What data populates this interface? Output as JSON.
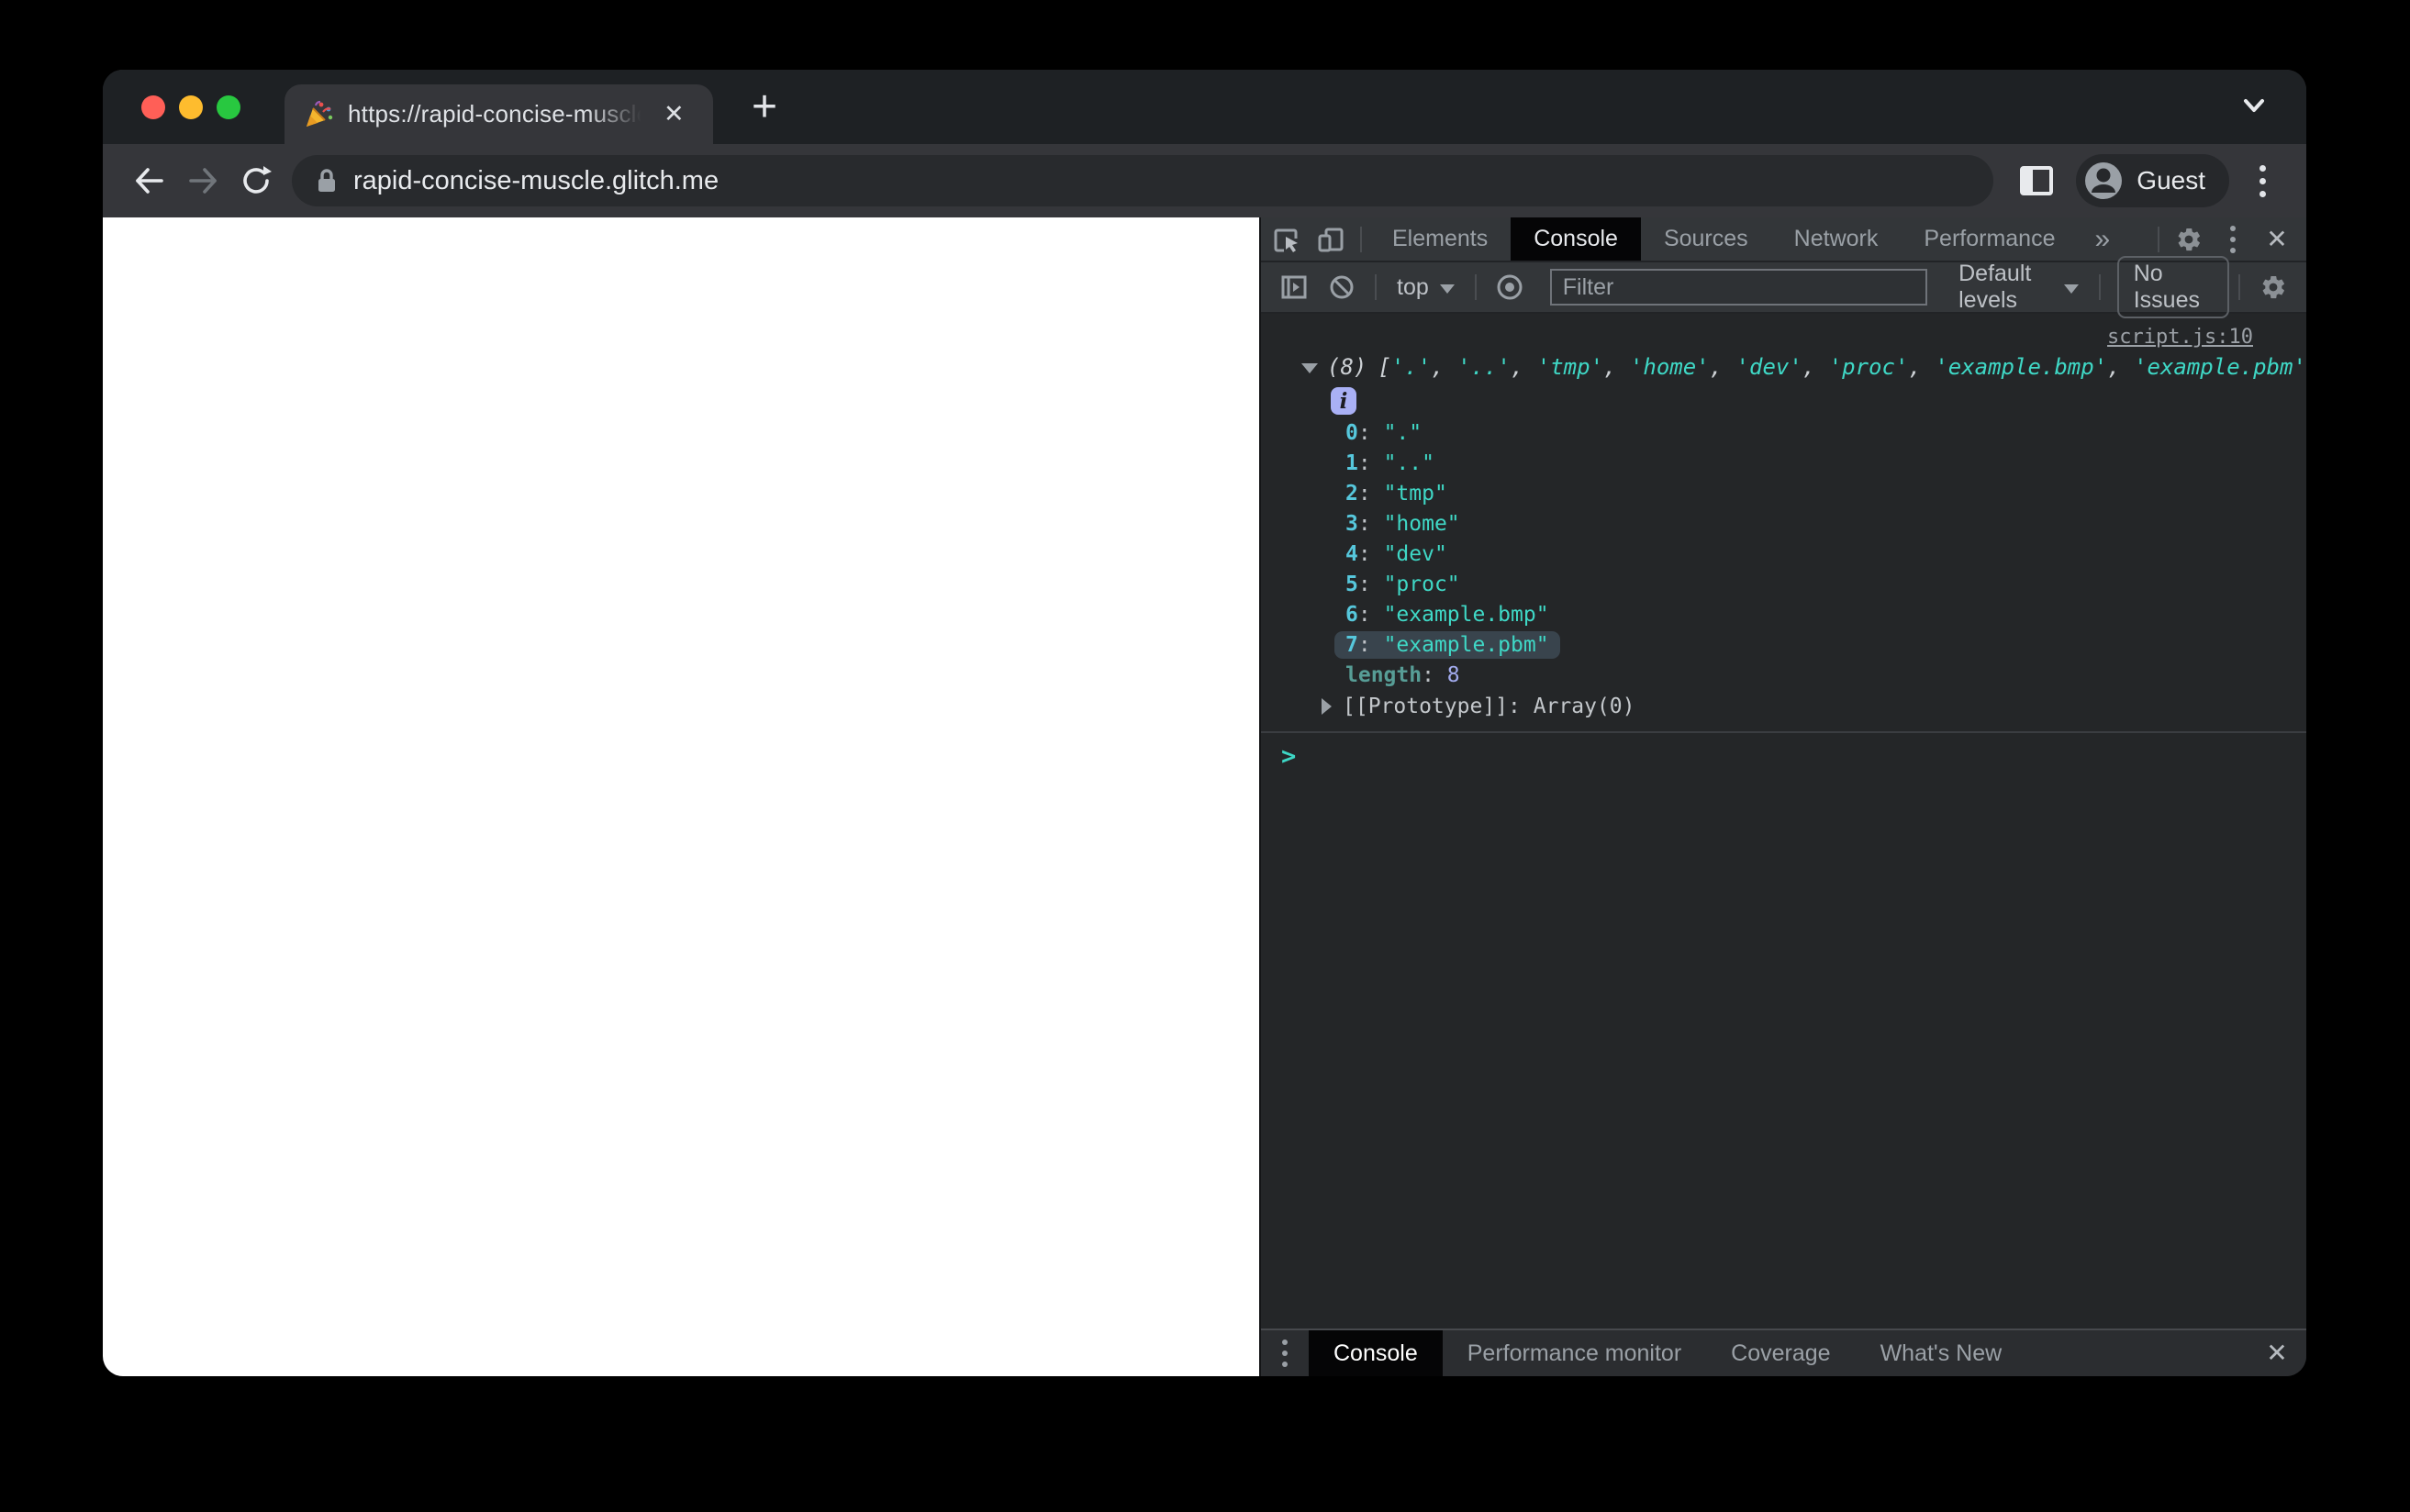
{
  "browser": {
    "tab": {
      "favicon_icon": "party-popper-icon",
      "title": "https://rapid-concise-muscle.g",
      "close_icon": "✕"
    },
    "new_tab_icon": "+",
    "url": "rapid-concise-muscle.glitch.me",
    "profile_label": "Guest"
  },
  "devtools": {
    "main_tabs": {
      "items": [
        "Elements",
        "Console",
        "Sources",
        "Network",
        "Performance"
      ],
      "active": "Console",
      "more_icon": "»"
    },
    "toolbar": {
      "context": "top",
      "filter_placeholder": "Filter",
      "levels_label": "Default levels",
      "issues_label": "No Issues"
    },
    "console": {
      "source_link": "script.js:10",
      "preview": {
        "count": "(8)",
        "bracket_open": "[",
        "separator": ", ",
        "bracket_close": "]",
        "items": [
          "'.'",
          "'..'",
          "'tmp'",
          "'home'",
          "'dev'",
          "'proc'",
          "'example.bmp'",
          "'example.pbm'"
        ]
      },
      "info_icon": "i",
      "colon": ": ",
      "rows": [
        {
          "k": "0",
          "v": "\".\""
        },
        {
          "k": "1",
          "v": "\"..\""
        },
        {
          "k": "2",
          "v": "\"tmp\""
        },
        {
          "k": "3",
          "v": "\"home\""
        },
        {
          "k": "4",
          "v": "\"dev\""
        },
        {
          "k": "5",
          "v": "\"proc\""
        },
        {
          "k": "6",
          "v": "\"example.bmp\""
        },
        {
          "k": "7",
          "v": "\"example.pbm\""
        }
      ],
      "highlighted_row": "7",
      "length_label": "length",
      "length_value": "8",
      "prototype_label": "[[Prototype]]",
      "prototype_value": "Array(0)",
      "prompt_icon": ">"
    },
    "drawer": {
      "tabs": [
        "Console",
        "Performance monitor",
        "Coverage",
        "What's New"
      ],
      "active": "Console",
      "overflow_icon": "⋮",
      "close_icon": "✕"
    }
  },
  "colors": {
    "string_teal": "#3FD8C6",
    "index_cyan": "#56C7DC",
    "number_purple": "#A2ABEE",
    "info_badge": "#A9B0F5",
    "highlight_row": "#39444D",
    "traffic_red": "#FF5F57",
    "traffic_yellow": "#FEBC2E",
    "traffic_green": "#28C840"
  }
}
